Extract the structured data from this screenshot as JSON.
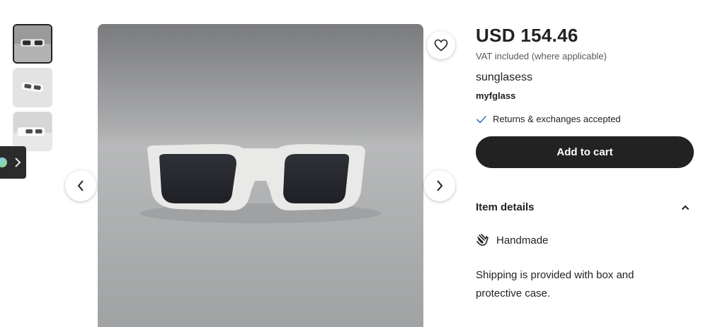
{
  "product": {
    "price": "USD 154.46",
    "vat_note": "VAT included (where applicable)",
    "title": "sunglasess",
    "shop_name": "myfglass",
    "returns_text": "Returns & exchanges accepted",
    "add_to_cart_label": "Add to cart"
  },
  "details": {
    "heading": "Item details",
    "handmade_label": "Handmade",
    "description": "Shipping is provided with box and protective case."
  },
  "icons": {
    "favorite": "heart-icon",
    "prev": "chevron-left-icon",
    "next": "chevron-right-icon",
    "returns": "checkmark-icon",
    "details_toggle": "chevron-up-icon",
    "handmade": "hand-wave-icon"
  },
  "colors": {
    "button_bg": "#222222",
    "check_accent": "#3e6cc7"
  }
}
